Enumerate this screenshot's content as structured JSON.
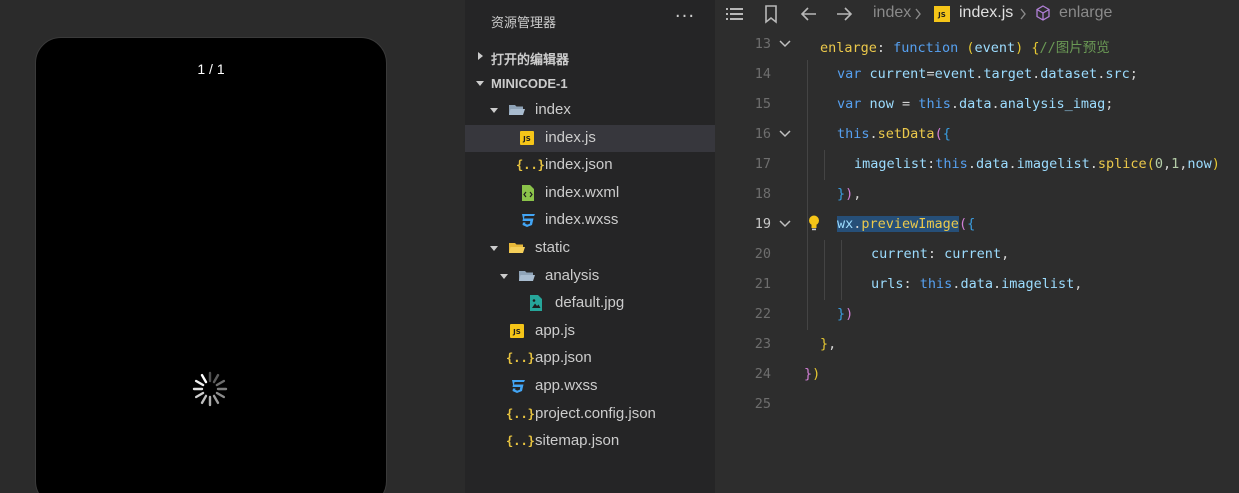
{
  "simulator": {
    "page_counter": "1 / 1"
  },
  "explorer": {
    "title": "资源管理器",
    "more_label": "···",
    "open_editors_label": "打开的编辑器",
    "project_label": "MINICODE-1",
    "tree": [
      {
        "name": "index",
        "type": "folder",
        "depth": 1,
        "expanded": true
      },
      {
        "name": "index.js",
        "type": "js",
        "depth": 2,
        "selected": true
      },
      {
        "name": "index.json",
        "type": "json",
        "depth": 2
      },
      {
        "name": "index.wxml",
        "type": "wxml",
        "depth": 2
      },
      {
        "name": "index.wxss",
        "type": "wxss",
        "depth": 2
      },
      {
        "name": "static",
        "type": "folder",
        "depth": 1,
        "expanded": true
      },
      {
        "name": "analysis",
        "type": "folder",
        "depth": 2,
        "expanded": true
      },
      {
        "name": "default.jpg",
        "type": "image",
        "depth": 3
      },
      {
        "name": "app.js",
        "type": "js",
        "depth": 1
      },
      {
        "name": "app.json",
        "type": "json",
        "depth": 1
      },
      {
        "name": "app.wxss",
        "type": "wxss",
        "depth": 1
      },
      {
        "name": "project.config.json",
        "type": "json",
        "depth": 1
      },
      {
        "name": "sitemap.json",
        "type": "json",
        "depth": 1
      }
    ]
  },
  "editor": {
    "breadcrumb": {
      "folder": "index",
      "file": "index.js",
      "symbol": "enlarge"
    },
    "active_line": 19,
    "lines": [
      {
        "num": "13",
        "fold": true,
        "indent": 1,
        "tokens": [
          [
            "fn",
            "enlarge"
          ],
          [
            "plain",
            ": "
          ],
          [
            "kw",
            "function"
          ],
          [
            "plain",
            " "
          ],
          [
            "br1",
            "("
          ],
          [
            "prop",
            "event"
          ],
          [
            "br1",
            ")"
          ],
          [
            "plain",
            " "
          ],
          [
            "br1",
            "{"
          ],
          [
            "cm",
            "//图片预览"
          ]
        ]
      },
      {
        "num": "14",
        "indent": 2,
        "tokens": [
          [
            "kw",
            "var"
          ],
          [
            "plain",
            " "
          ],
          [
            "prop",
            "current"
          ],
          [
            "plain",
            "="
          ],
          [
            "prop",
            "event"
          ],
          [
            "plain",
            "."
          ],
          [
            "prop",
            "target"
          ],
          [
            "plain",
            "."
          ],
          [
            "prop",
            "dataset"
          ],
          [
            "plain",
            "."
          ],
          [
            "prop",
            "src"
          ],
          [
            "plain",
            ";"
          ]
        ]
      },
      {
        "num": "15",
        "indent": 2,
        "tokens": [
          [
            "kw",
            "var"
          ],
          [
            "plain",
            " "
          ],
          [
            "prop",
            "now"
          ],
          [
            "plain",
            " = "
          ],
          [
            "this",
            "this"
          ],
          [
            "plain",
            "."
          ],
          [
            "prop",
            "data"
          ],
          [
            "plain",
            "."
          ],
          [
            "prop",
            "analysis_imag"
          ],
          [
            "plain",
            ";"
          ]
        ]
      },
      {
        "num": "16",
        "fold": true,
        "indent": 2,
        "tokens": [
          [
            "this",
            "this"
          ],
          [
            "plain",
            "."
          ],
          [
            "fn",
            "setData"
          ],
          [
            "br2",
            "("
          ],
          [
            "br3",
            "{"
          ]
        ]
      },
      {
        "num": "17",
        "indent": 3,
        "tokens": [
          [
            "prop",
            "imagelist"
          ],
          [
            "plain",
            ":"
          ],
          [
            "this",
            "this"
          ],
          [
            "plain",
            "."
          ],
          [
            "prop",
            "data"
          ],
          [
            "plain",
            "."
          ],
          [
            "prop",
            "imagelist"
          ],
          [
            "plain",
            "."
          ],
          [
            "fn",
            "splice"
          ],
          [
            "br1",
            "("
          ],
          [
            "num",
            "0"
          ],
          [
            "plain",
            ","
          ],
          [
            "num",
            "1"
          ],
          [
            "plain",
            ","
          ],
          [
            "prop",
            "now"
          ],
          [
            "br1",
            ")"
          ]
        ]
      },
      {
        "num": "18",
        "indent": 2,
        "tokens": [
          [
            "br3",
            "}"
          ],
          [
            "br2",
            ")"
          ],
          [
            "plain",
            ","
          ]
        ]
      },
      {
        "num": "19",
        "fold": true,
        "bulb": true,
        "indent": 2,
        "tokens": [
          [
            "hlprop",
            "wx"
          ],
          [
            "hlplain",
            "."
          ],
          [
            "hlfn",
            "previewImage"
          ],
          [
            "br2",
            "("
          ],
          [
            "br3",
            "{"
          ]
        ]
      },
      {
        "num": "20",
        "indent": 4,
        "tokens": [
          [
            "prop",
            "current"
          ],
          [
            "plain",
            ": "
          ],
          [
            "prop",
            "current"
          ],
          [
            "plain",
            ","
          ]
        ]
      },
      {
        "num": "21",
        "indent": 4,
        "tokens": [
          [
            "prop",
            "urls"
          ],
          [
            "plain",
            ": "
          ],
          [
            "this",
            "this"
          ],
          [
            "plain",
            "."
          ],
          [
            "prop",
            "data"
          ],
          [
            "plain",
            "."
          ],
          [
            "prop",
            "imagelist"
          ],
          [
            "plain",
            ","
          ]
        ]
      },
      {
        "num": "22",
        "indent": 2,
        "tokens": [
          [
            "br3",
            "}"
          ],
          [
            "br2",
            ")"
          ]
        ]
      },
      {
        "num": "23",
        "indent": 1,
        "tokens": [
          [
            "br1",
            "}"
          ],
          [
            "plain",
            ","
          ]
        ]
      },
      {
        "num": "24",
        "indent": 0,
        "tokens": [
          [
            "br2",
            "}"
          ],
          [
            "br1",
            ")"
          ]
        ]
      },
      {
        "num": "25",
        "indent": 0,
        "tokens": []
      }
    ]
  }
}
